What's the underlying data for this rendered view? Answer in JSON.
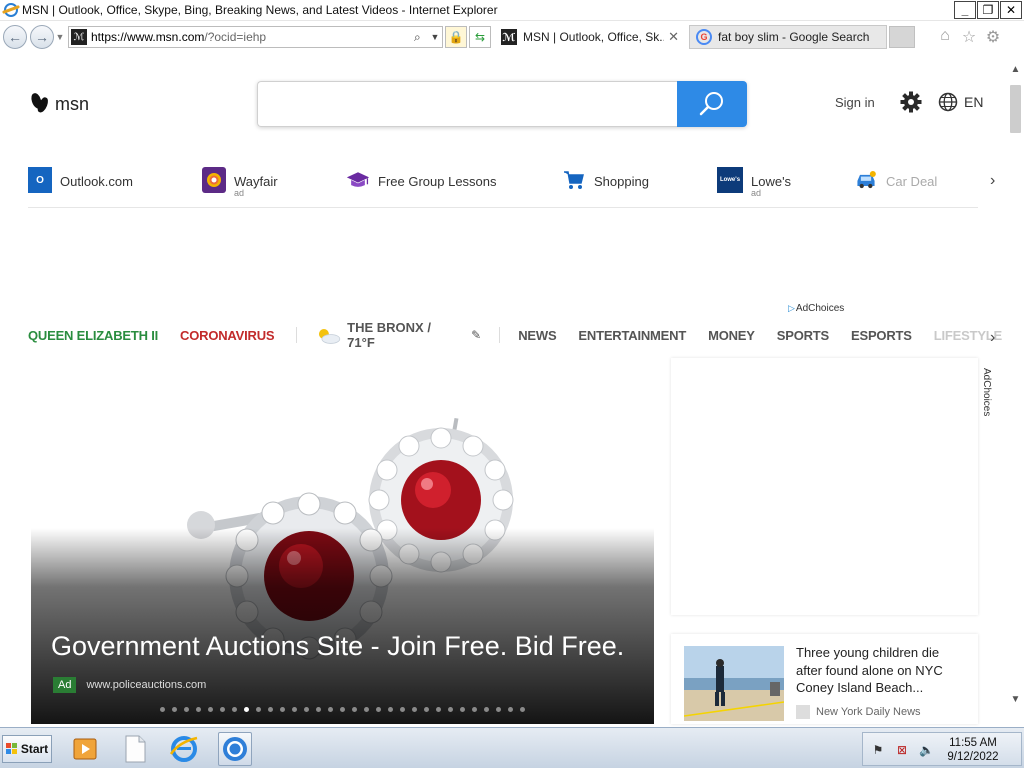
{
  "window": {
    "title": "MSN | Outlook, Office, Skype, Bing, Breaking News, and Latest Videos - Internet Explorer",
    "minimize": "_",
    "restore": "❐",
    "close": "✕"
  },
  "addressbar": {
    "url_host": "https://www.msn.com",
    "url_rest": "/?ocid=iehp"
  },
  "tabs": [
    {
      "label": "MSN | Outlook, Office, Sk...",
      "close": "✕"
    },
    {
      "label": "fat boy slim - Google Search"
    }
  ],
  "msn": {
    "logo_text": "msn",
    "search_placeholder": "",
    "signin": "Sign in",
    "language": "EN"
  },
  "quick_links": [
    {
      "label": "Outlook.com",
      "ad": ""
    },
    {
      "label": "Wayfair",
      "ad": "ad"
    },
    {
      "label": "Free Group Lessons",
      "ad": ""
    },
    {
      "label": "Shopping",
      "ad": ""
    },
    {
      "label": "Lowe's",
      "ad": "ad",
      "icon_text": "Lowe's"
    },
    {
      "label": "Car Deal",
      "ad": ""
    }
  ],
  "adchoices": "AdChoices",
  "categories": {
    "queen": "QUEEN ELIZABETH II",
    "corona": "CORONAVIRUS",
    "weather": "THE BRONX / 71°F",
    "items": [
      "NEWS",
      "ENTERTAINMENT",
      "MONEY",
      "SPORTS",
      "ESPORTS",
      "LIFESTYLE"
    ]
  },
  "hero": {
    "headline": "Government Auctions Site - Join Free. Bid Free.",
    "ad_badge": "Ad",
    "ad_url": "www.policeauctions.com",
    "slides_total": 31,
    "slide_active": 8
  },
  "news_card": {
    "headline": "Three young children die after found alone on NYC Coney Island Beach...",
    "source": "New York Daily News"
  },
  "taskbar": {
    "start": "Start",
    "time": "11:55 AM",
    "date": "9/12/2022"
  },
  "colors": {
    "accent_blue": "#2e8ae6",
    "queen_green": "#2a8d3f",
    "corona_red": "#c22b2b"
  }
}
